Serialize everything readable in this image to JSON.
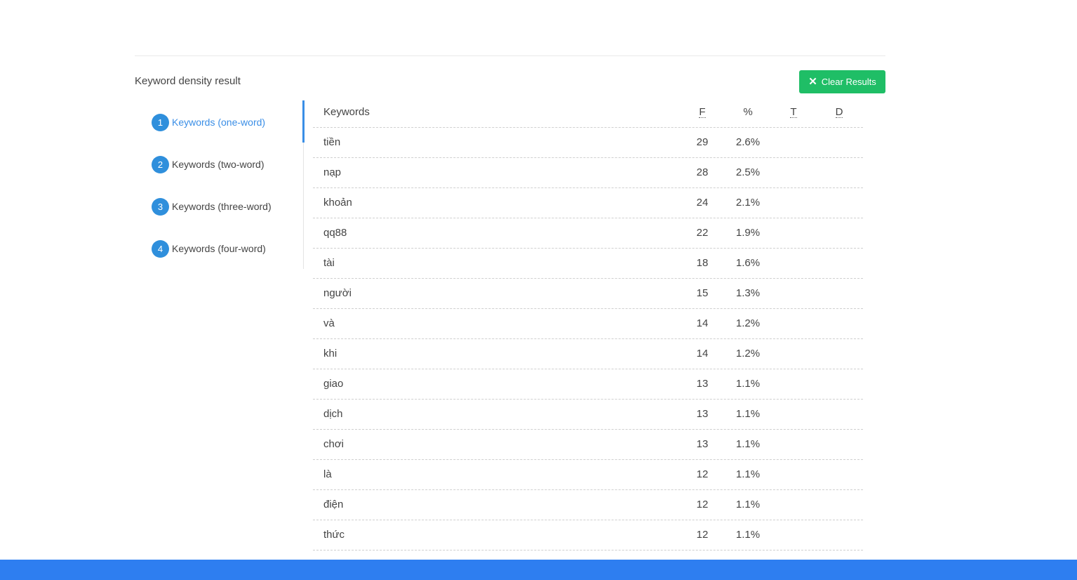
{
  "section_title": "Keyword density result",
  "clear_button": {
    "label": "Clear Results",
    "icon": "close-icon"
  },
  "tabs": [
    {
      "num": "1",
      "label": "Keywords (one-word)",
      "active": true
    },
    {
      "num": "2",
      "label": "Keywords (two-word)",
      "active": false
    },
    {
      "num": "3",
      "label": "Keywords (three-word)",
      "active": false
    },
    {
      "num": "4",
      "label": "Keywords (four-word)",
      "active": false
    }
  ],
  "table": {
    "headers": {
      "keyword": "Keywords",
      "f": "F",
      "percent": "%",
      "t": "T",
      "d": "D"
    },
    "rows": [
      {
        "keyword": "tiền",
        "f": "29",
        "percent": "2.6%"
      },
      {
        "keyword": "nạp",
        "f": "28",
        "percent": "2.5%"
      },
      {
        "keyword": "khoản",
        "f": "24",
        "percent": "2.1%"
      },
      {
        "keyword": "qq88",
        "f": "22",
        "percent": "1.9%"
      },
      {
        "keyword": "tài",
        "f": "18",
        "percent": "1.6%"
      },
      {
        "keyword": "người",
        "f": "15",
        "percent": "1.3%"
      },
      {
        "keyword": "và",
        "f": "14",
        "percent": "1.2%"
      },
      {
        "keyword": "khi",
        "f": "14",
        "percent": "1.2%"
      },
      {
        "keyword": "giao",
        "f": "13",
        "percent": "1.1%"
      },
      {
        "keyword": "dịch",
        "f": "13",
        "percent": "1.1%"
      },
      {
        "keyword": "chơi",
        "f": "13",
        "percent": "1.1%"
      },
      {
        "keyword": "là",
        "f": "12",
        "percent": "1.1%"
      },
      {
        "keyword": "điện",
        "f": "12",
        "percent": "1.1%"
      },
      {
        "keyword": "thức",
        "f": "12",
        "percent": "1.1%"
      }
    ]
  },
  "colors": {
    "accent": "#3a8ee6",
    "button": "#1fbe66",
    "footer": "#2e7ef0"
  }
}
